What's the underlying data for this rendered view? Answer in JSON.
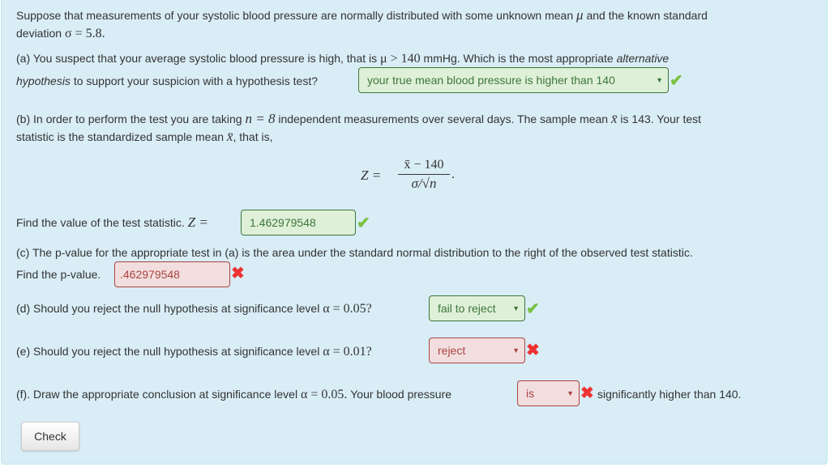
{
  "intro": {
    "text1": "Suppose that measurements of your systolic blood pressure are normally distributed with some unknown mean ",
    "mu": "μ",
    "text2": " and the known standard",
    "text3": "deviation ",
    "sigma_expr": "σ = 5.8."
  },
  "part_a": {
    "text1": "(a) You suspect that your average systolic blood pressure is high, that is ",
    "math": "μ > 140",
    "text2": " mmHg. Which is the most appropriate ",
    "italic": "alternative",
    "line2_italic": "hypothesis",
    "line2_text": " to support your suspicion with a hypothesis test?",
    "answer": "your true mean blood pressure is higher than 140",
    "status": "correct"
  },
  "part_b": {
    "text1": "(b) In order to perform the test you are taking ",
    "n_expr": "n = 8",
    "text2": " independent measurements over several days. The sample mean ",
    "xbar": "x̄",
    "text3": " is 143. Your test",
    "line2": "statistic is the standardized sample mean ",
    "line2_end": ", that is,",
    "formula": {
      "lhs": "Z =",
      "numerator": "x̄ − 140",
      "denominator": "σ/√n",
      "end": "."
    },
    "find_label": "Find the value of the test statistic. ",
    "find_math": "Z =",
    "answer": "1.462979548",
    "status": "correct"
  },
  "part_c": {
    "text1": "(c) The p-value for the appropriate test in (a) is the area under the standard normal distribution to the right of the observed test statistic.",
    "find_label": "Find the p-value.",
    "answer": ".462979548",
    "status": "incorrect"
  },
  "part_d": {
    "text1": "(d) Should you reject the null hypothesis at significance level ",
    "math": "α = 0.05?",
    "answer": "fail to reject",
    "status": "correct"
  },
  "part_e": {
    "text1": "(e) Should you reject the null hypothesis at significance level ",
    "math": "α = 0.01?",
    "answer": "reject",
    "status": "incorrect"
  },
  "part_f": {
    "text1": "(f). Draw the appropriate conclusion at significance level ",
    "math": "α = 0.05.",
    "text2": " Your blood pressure",
    "answer": "is",
    "status": "incorrect",
    "text3": "significantly higher than 140."
  },
  "icons": {
    "correct": "✔",
    "incorrect": "✖",
    "caret": "▼"
  },
  "check_button": "Check",
  "colors": {
    "panel_bg": "#d9edf7",
    "correct_bg": "#dff0d8",
    "correct_text": "#3c763d",
    "incorrect_bg": "#f2dede",
    "incorrect_text": "#a94442",
    "check_mark": "#7ac142",
    "cross_mark": "#ee3333"
  }
}
